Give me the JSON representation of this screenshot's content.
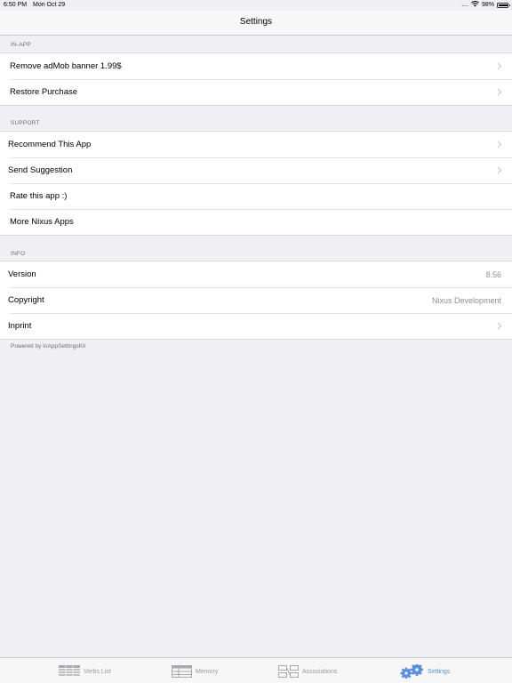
{
  "status_bar": {
    "time": "6:50 PM",
    "date": "Mon Oct 29",
    "signal": "....",
    "battery": "98%"
  },
  "nav": {
    "title": "Settings"
  },
  "sections": {
    "inapp": {
      "header": "IN-APP",
      "rows": [
        {
          "label": "Remove adMob banner 1.99$"
        },
        {
          "label": "Restore Purchase"
        }
      ]
    },
    "support": {
      "header": "SUPPORT",
      "rows": [
        {
          "label": "Recommend This App"
        },
        {
          "label": "Send Suggestion"
        },
        {
          "label": "Rate this app :)"
        },
        {
          "label": "More Nixus Apps"
        }
      ]
    },
    "info": {
      "header": "INFO",
      "rows": [
        {
          "label": "Version",
          "detail": "8.56"
        },
        {
          "label": "Copyright",
          "detail": "Nixus Development"
        },
        {
          "label": "Inprint"
        }
      ]
    }
  },
  "footer": "Powered by InAppSettingsKit",
  "tabs": [
    {
      "label": "Verbs List",
      "icon": "list-grid-icon"
    },
    {
      "label": "Memory",
      "icon": "memory-table-icon"
    },
    {
      "label": "Associations",
      "icon": "associations-icon"
    },
    {
      "label": "Settings",
      "icon": "gears-icon"
    }
  ],
  "colors": {
    "accent": "#5b8ee0",
    "background": "#efeff4",
    "secondary_text": "#8e8e93"
  }
}
